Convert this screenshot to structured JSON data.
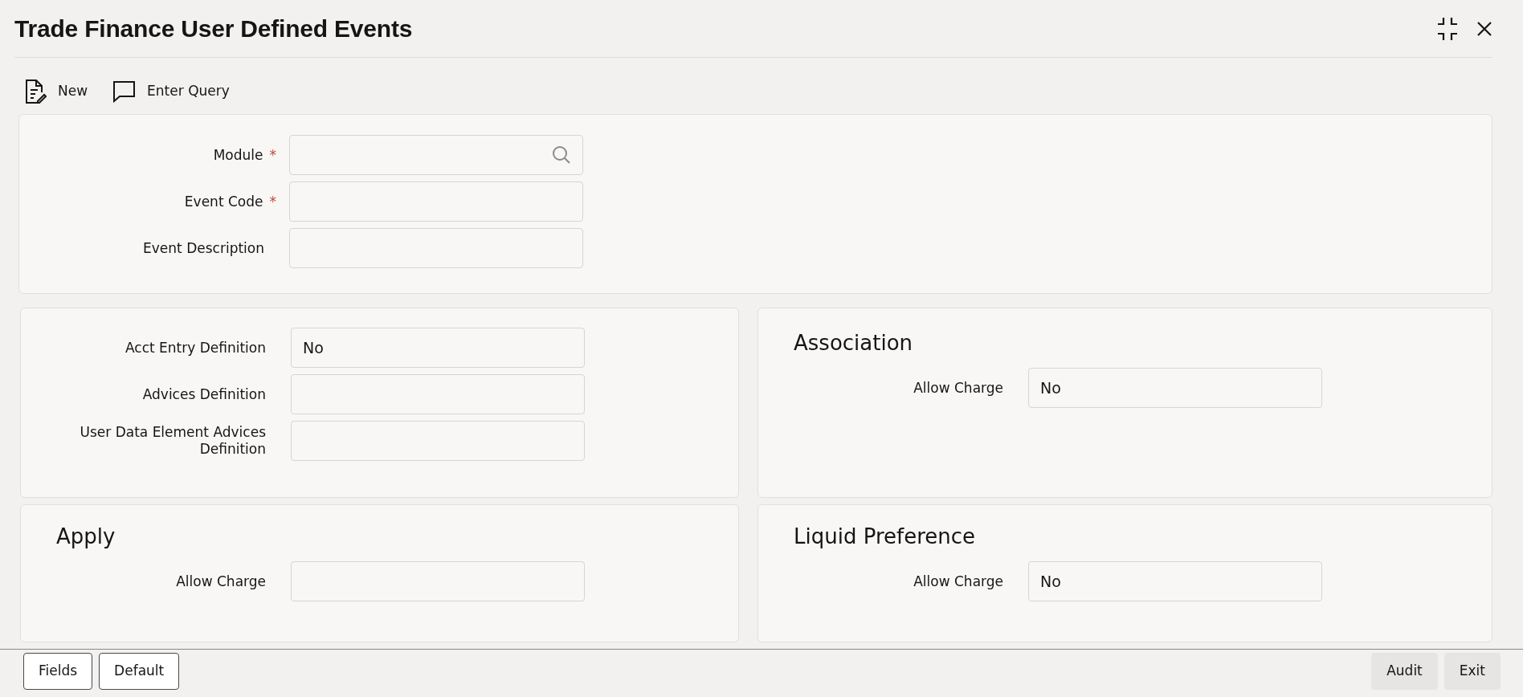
{
  "window": {
    "title": "Trade Finance User Defined Events"
  },
  "toolbar": [
    {
      "kind": "new",
      "label": "New"
    },
    {
      "kind": "query",
      "label": "Enter Query"
    }
  ],
  "main_section": {
    "fields": [
      {
        "label": "Module",
        "marker": "*",
        "kind": "lookup"
      },
      {
        "label": "Event Code",
        "marker": "*",
        "kind": "text"
      },
      {
        "label": "Event Description",
        "kind": "text"
      }
    ]
  },
  "sections": [
    {
      "fields": [
        {
          "label": "Acct Entry Definition",
          "kind": "text",
          "value": "No"
        },
        {
          "label": "Advices Definition",
          "kind": "text"
        },
        {
          "label": "User Data Element Advices Definition",
          "kind": "text"
        }
      ]
    },
    {
      "heading": "Association",
      "fields": [
        {
          "label": "Allow Charge",
          "kind": "text",
          "value": "No"
        }
      ]
    },
    {
      "heading": "Apply",
      "fields": [
        {
          "label": "Allow Charge",
          "kind": "text"
        }
      ]
    },
    {
      "heading": "Liquid Preference",
      "fields": [
        {
          "label": "Allow Charge",
          "kind": "text",
          "value": "No"
        }
      ]
    }
  ],
  "footer": {
    "left_buttons": [
      {
        "label": "Fields",
        "kind": "outline"
      },
      {
        "label": "Default",
        "kind": "outline"
      }
    ],
    "right_buttons": [
      {
        "label": "Audit",
        "kind": "filled"
      },
      {
        "label": "Exit",
        "kind": "filled"
      }
    ]
  }
}
